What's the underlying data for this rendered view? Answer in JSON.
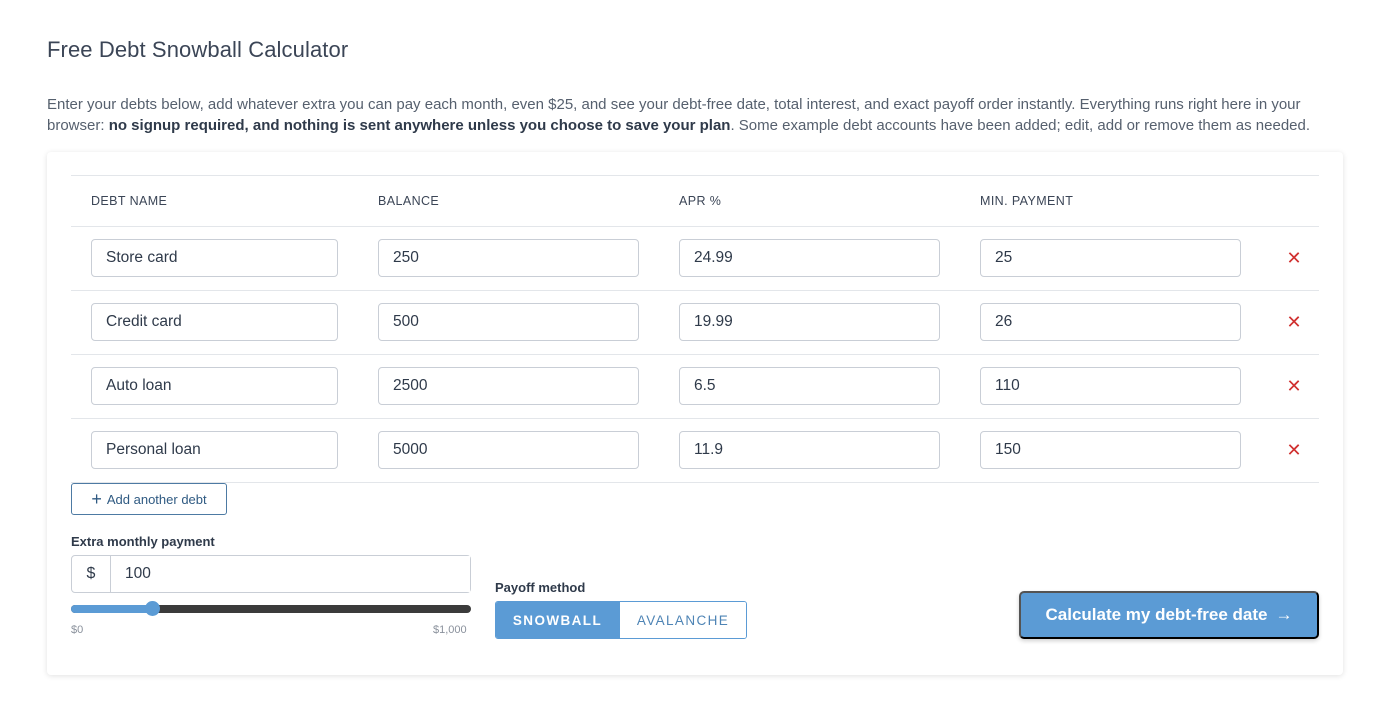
{
  "page": {
    "title": "Free Debt Snowball Calculator",
    "intro_part1": "Enter your debts below, add whatever extra you can pay each month, even $25, and see your debt-free date, total interest, and exact payoff order instantly. Everything runs right here in your browser: ",
    "intro_bold": "no signup required, and nothing is sent anywhere unless you choose to save your plan",
    "intro_part2": ". Some example debt accounts have been added; edit, add or remove them as needed."
  },
  "table": {
    "headers": {
      "name": "DEBT NAME",
      "balance": "BALANCE",
      "apr": "APR %",
      "min_payment": "MIN. PAYMENT"
    },
    "rows": [
      {
        "name": "Store card",
        "balance": "250",
        "apr": "24.99",
        "min_payment": "25"
      },
      {
        "name": "Credit card",
        "balance": "500",
        "apr": "19.99",
        "min_payment": "26"
      },
      {
        "name": "Auto loan",
        "balance": "2500",
        "apr": "6.5",
        "min_payment": "110"
      },
      {
        "name": "Personal loan",
        "balance": "5000",
        "apr": "11.9",
        "min_payment": "150"
      }
    ],
    "remove_icon": "close-icon",
    "remove_glyph": "✕",
    "add_label": "Add another debt",
    "add_glyph": "+"
  },
  "extra": {
    "label": "Extra monthly payment",
    "prefix": "$",
    "value": "100",
    "slider_min_label": "$0",
    "slider_max_label": "$1,000",
    "slider_min": 0,
    "slider_max": 1000,
    "slider_value": 100
  },
  "method": {
    "label": "Payoff method",
    "options": [
      "SNOWBALL",
      "AVALANCHE"
    ],
    "selected": "SNOWBALL"
  },
  "calculate": {
    "label": "Calculate my debt-free date",
    "arrow": "→"
  },
  "colors": {
    "accent": "#5b9bd5",
    "remove": "#d0302f",
    "outline_button": "#4d7aa3"
  }
}
